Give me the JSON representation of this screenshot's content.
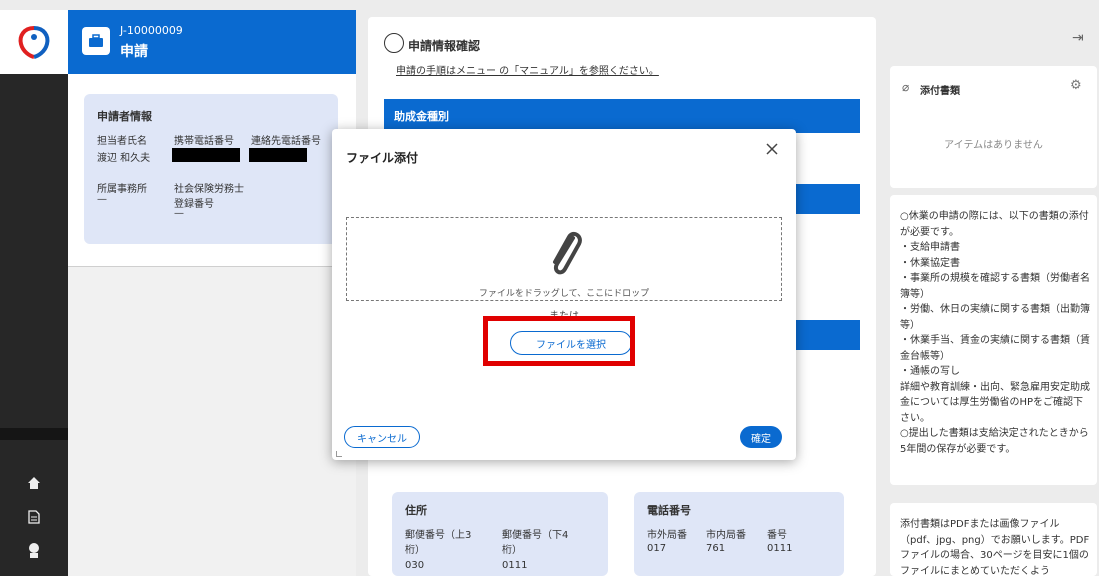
{
  "header": {
    "case_id": "J-10000009",
    "title": "申請"
  },
  "applicant": {
    "section_title": "申請者情報",
    "col_contact_name": "担当者氏名",
    "col_mobile": "携帯電話番号",
    "col_contact_phone": "連絡先電話番号",
    "contact_name": "渡辺 和久夫",
    "col_office": "所属事務所",
    "col_labor_consultant": "社会保険労務士\n登録番号",
    "office": "—",
    "labor_consultant": "—"
  },
  "center": {
    "title": "申請情報確認",
    "manual_link": "申請の手順はメニュー の「マニュアル」を参照ください。",
    "section_subsidy": "助成金種別",
    "address_card": {
      "title": "住所",
      "zip_upper_label": "郵便番号（上3桁）",
      "zip_lower_label": "郵便番号（下4桁）",
      "zip_upper": "030",
      "zip_lower": "0111"
    },
    "phone_card": {
      "title": "電話番号",
      "area_label": "市外局番",
      "local_label": "市内局番",
      "number_label": "番号",
      "area": "017",
      "local": "761",
      "number": "0111"
    }
  },
  "attachments": {
    "title": "添付書類",
    "empty": "アイテムはありません"
  },
  "notes": {
    "required_docs": "○休業の申請の際には、以下の書類の添付が必要です。\n・支給申請書\n・休業協定書\n・事業所の規模を確認する書類（労働者名簿等）\n・労働、休日の実績に関する書類（出勤簿等）\n・休業手当、賃金の実績に関する書類（賃金台帳等）\n・通帳の写し\n詳細や教育訓練・出向、緊急雇用安定助成金については厚生労働省のHPをご確認下さい。\n○提出した書類は支給決定されたときから5年間の保存が必要です。",
    "file_format": "添付書類はPDFまたは画像ファイル（pdf、jpg、png）でお願いします。PDFファイルの場合、30ページを目安に1個のファイルにまとめていただくよう"
  },
  "modal": {
    "title": "ファイル添付",
    "drop_label": "ファイルをドラッグして、ここにドロップ",
    "or_label": "または",
    "choose_file": "ファイルを選択",
    "cancel": "キャンセル",
    "confirm": "確定"
  },
  "colors": {
    "primary": "#0a6ad0",
    "highlight": "#e00000",
    "rail": "#272727",
    "card": "#dfe6f7"
  }
}
